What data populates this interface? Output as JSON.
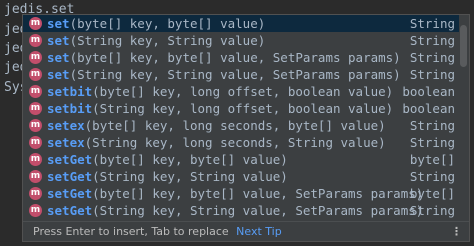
{
  "editor": {
    "lines": [
      "jedis.set",
      "jed",
      "jed",
      "jed",
      "Sys"
    ]
  },
  "popup": {
    "items": [
      {
        "icon": "method-icon",
        "icon_letter": "m",
        "name": "set",
        "params": "(byte[] key, byte[] value)",
        "type": "String",
        "selected": true
      },
      {
        "icon": "method-icon",
        "icon_letter": "m",
        "name": "set",
        "params": "(String key, String value)",
        "type": "String"
      },
      {
        "icon": "method-icon",
        "icon_letter": "m",
        "name": "set",
        "params": "(byte[] key, byte[] value, SetParams params)",
        "type": "String"
      },
      {
        "icon": "method-icon",
        "icon_letter": "m",
        "name": "set",
        "params": "(String key, String value, SetParams params)",
        "type": "String"
      },
      {
        "icon": "method-icon",
        "icon_letter": "m",
        "name": "setbit",
        "params": "(byte[] key, long offset, boolean value)",
        "type": "boolean"
      },
      {
        "icon": "method-icon",
        "icon_letter": "m",
        "name": "setbit",
        "params": "(String key, long offset, boolean value)",
        "type": "boolean"
      },
      {
        "icon": "method-icon",
        "icon_letter": "m",
        "name": "setex",
        "params": "(byte[] key, long seconds, byte[] value)",
        "type": "String"
      },
      {
        "icon": "method-icon",
        "icon_letter": "m",
        "name": "setex",
        "params": "(String key, long seconds, String value)",
        "type": "String"
      },
      {
        "icon": "method-icon",
        "icon_letter": "m",
        "name": "setGet",
        "params": "(byte[] key, byte[] value)",
        "type": "byte[]"
      },
      {
        "icon": "method-icon",
        "icon_letter": "m",
        "name": "setGet",
        "params": "(String key, String value)",
        "type": "String"
      },
      {
        "icon": "method-icon",
        "icon_letter": "m",
        "name": "setGet",
        "params": "(byte[] key, byte[] value, SetParams params)",
        "type": "byte[]"
      },
      {
        "icon": "method-icon",
        "icon_letter": "m",
        "name": "setGet",
        "params": "(String key, String value, SetParams params)",
        "type": "String"
      }
    ],
    "footer": {
      "hint": "Press Enter to insert, Tab to replace",
      "next_tip": "Next Tip",
      "more": "⋮"
    }
  },
  "colors": {
    "background": "#2b2b2b",
    "popup_bg": "#3c3f41",
    "selection": "#0d293e",
    "method_name": "#589df6",
    "method_icon": "#c24e6b"
  }
}
